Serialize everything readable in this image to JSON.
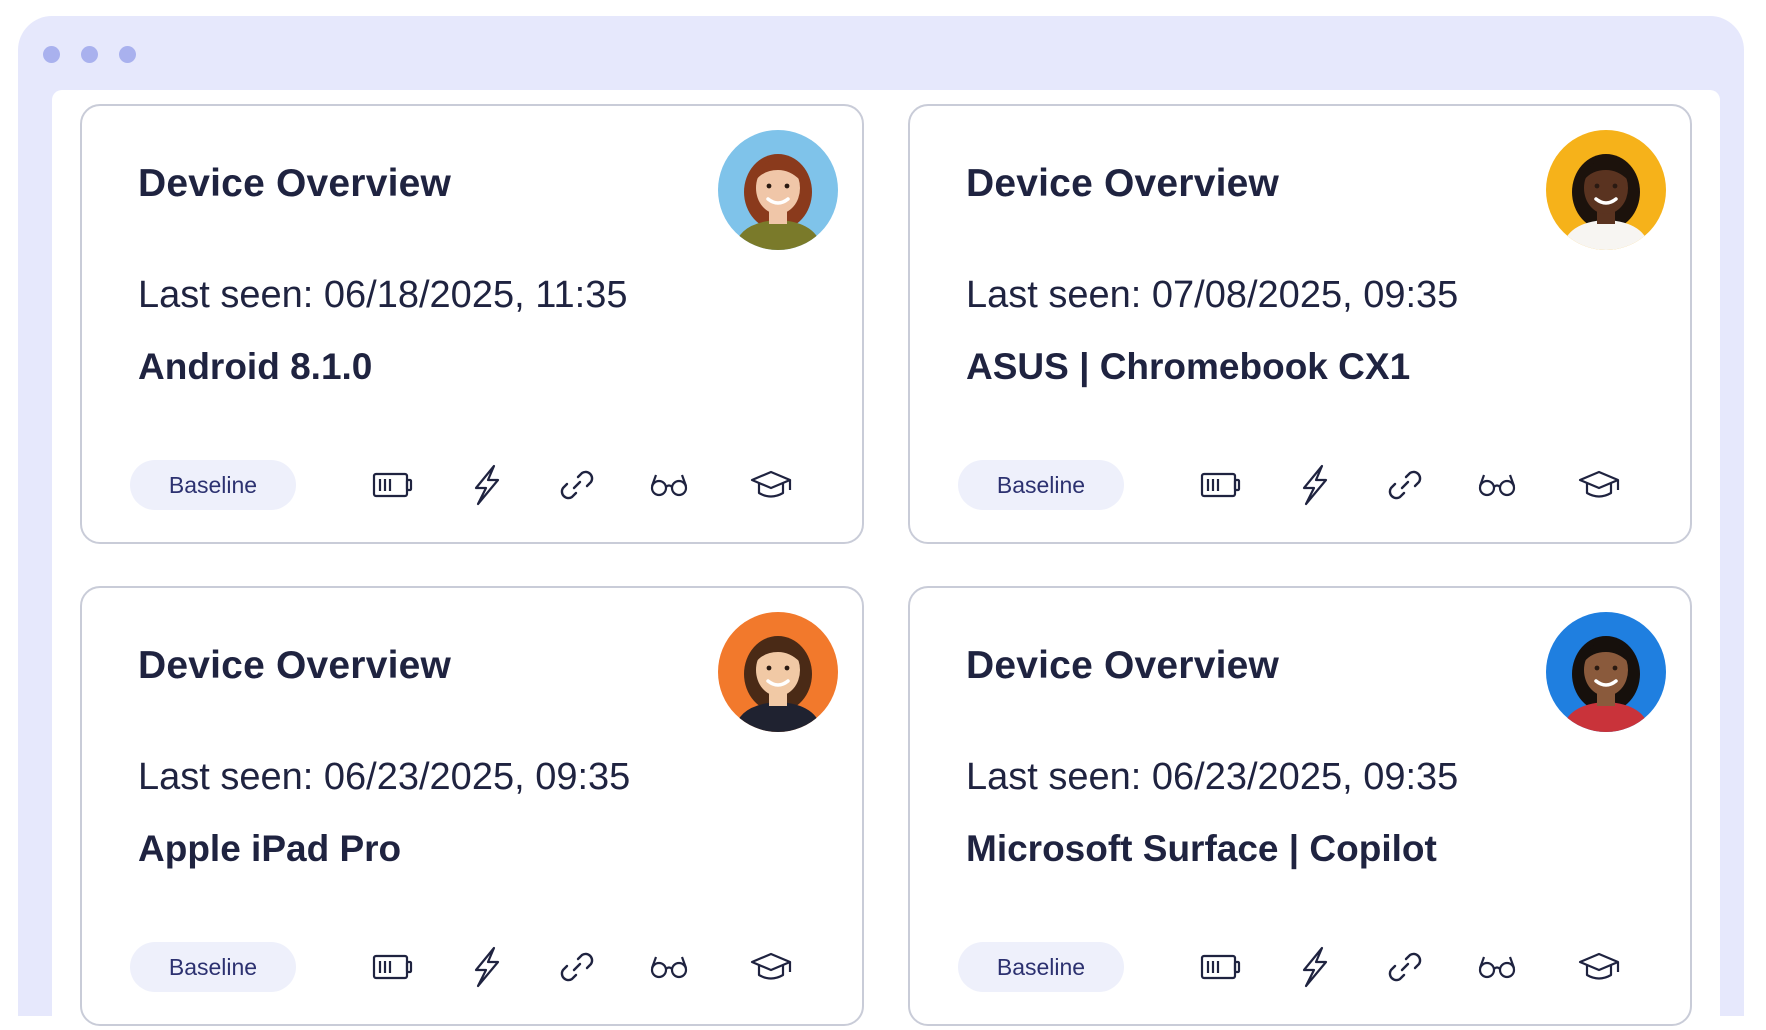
{
  "cards": [
    {
      "title": "Device Overview",
      "last_seen": "Last seen: 06/18/2025, 11:35",
      "device": "Android 8.1.0",
      "badge": "Baseline",
      "avatar_bg": "#7fc3ea",
      "avatar_skin": "#f0c6a8",
      "avatar_hair": "#8a3a1c",
      "avatar_shirt": "#7a7a2a"
    },
    {
      "title": "Device Overview",
      "last_seen": "Last seen: 07/08/2025, 09:35",
      "device": "ASUS | Chromebook CX1",
      "badge": "Baseline",
      "avatar_bg": "#f6b21a",
      "avatar_skin": "#5a3320",
      "avatar_hair": "#1c120c",
      "avatar_shirt": "#f7f5f2"
    },
    {
      "title": "Device Overview",
      "last_seen": "Last seen: 06/23/2025, 09:35",
      "device": "Apple iPad Pro",
      "badge": "Baseline",
      "avatar_bg": "#f2792c",
      "avatar_skin": "#f1c9a5",
      "avatar_hair": "#4a2a16",
      "avatar_shirt": "#1f2230"
    },
    {
      "title": "Device Overview",
      "last_seen": "Last seen: 06/23/2025, 09:35",
      "device": "Microsoft Surface  | Copilot",
      "badge": "Baseline",
      "avatar_bg": "#1f7fe0",
      "avatar_skin": "#8a5a3c",
      "avatar_hair": "#16100c",
      "avatar_shirt": "#c9333a"
    }
  ],
  "icons": [
    "battery-icon",
    "lightning-icon",
    "link-icon",
    "glasses-icon",
    "graduation-cap-icon"
  ],
  "colors": {
    "frame": "#e6e8fc",
    "window_dot": "#a9b1ee",
    "card_border": "#c9ccd8",
    "text": "#1f2340",
    "badge_bg": "#eef0fb",
    "badge_text": "#2c3170"
  }
}
